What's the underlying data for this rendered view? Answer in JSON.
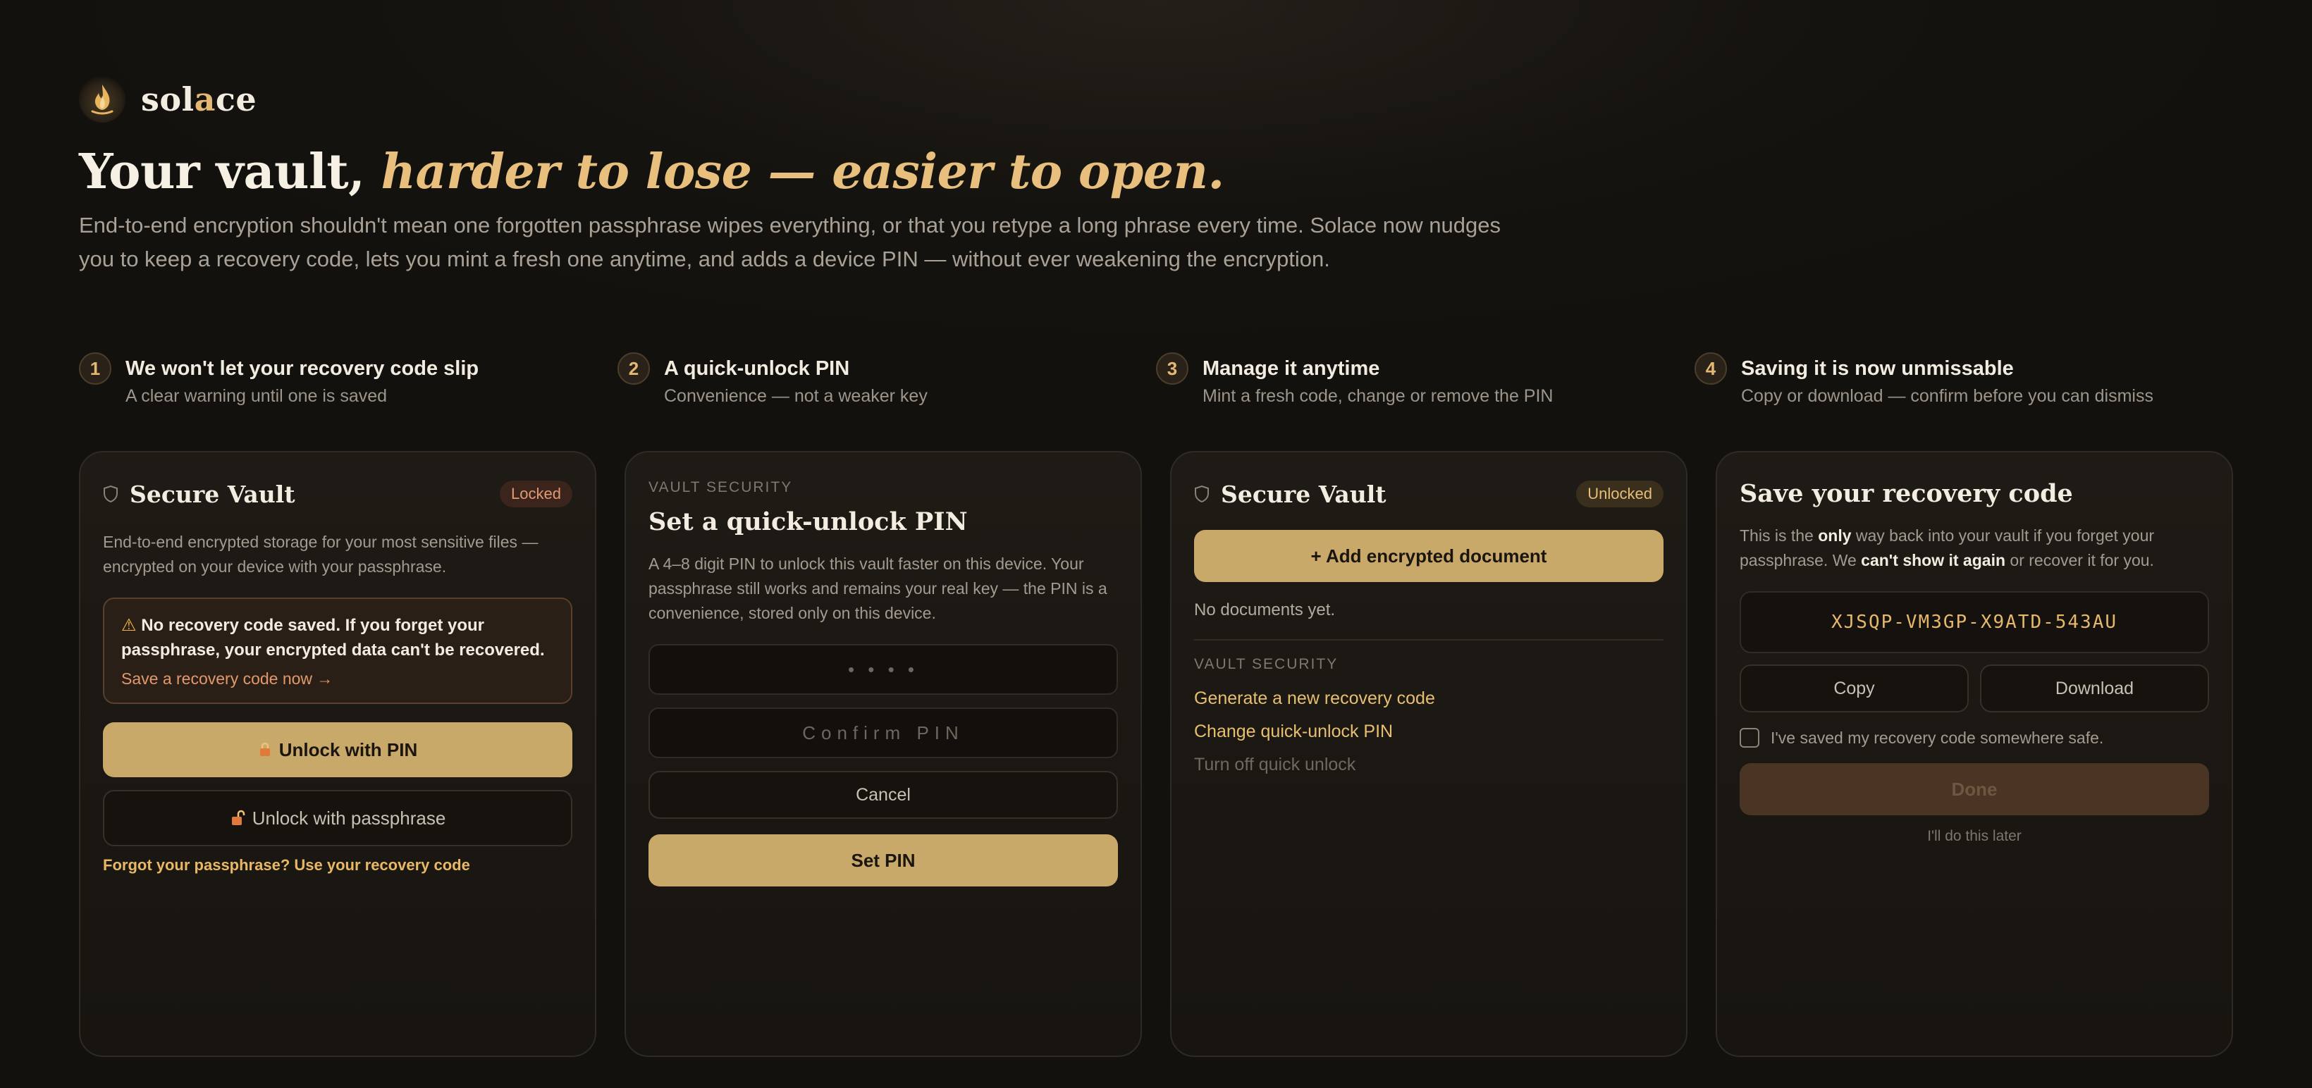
{
  "brand": {
    "name_pre": "sol",
    "name_accent": "a",
    "name_post": "ce"
  },
  "hero": {
    "headline_plain": "Your vault, ",
    "headline_accent": "harder to lose — easier to open.",
    "lede": "End-to-end encryption shouldn't mean one forgotten passphrase wipes everything, or that you retype a long phrase every time. Solace now nudges you to keep a recovery code, lets you mint a fresh one anytime, and adds a device PIN — without ever weakening the encryption."
  },
  "steps": [
    {
      "num": "1",
      "title": "We won't let your recovery code slip",
      "sub": "A clear warning until one is saved"
    },
    {
      "num": "2",
      "title": "A quick-unlock PIN",
      "sub": "Convenience — not a weaker key"
    },
    {
      "num": "3",
      "title": "Manage it anytime",
      "sub": "Mint a fresh code, change or remove the PIN"
    },
    {
      "num": "4",
      "title": "Saving it is now unmissable",
      "sub": "Copy or download — confirm before you can dismiss"
    }
  ],
  "card1": {
    "title": "Secure Vault",
    "badge": "Locked",
    "desc": "End-to-end encrypted storage for your most sensitive files — encrypted on your device with your passphrase.",
    "warning": "No recovery code saved. If you forget your passphrase, your encrypted data can't be recovered.",
    "warning_icon": "⚠",
    "warning_link": "Save a recovery code now →",
    "pin_button": "Unlock with PIN",
    "passphrase_button": "Unlock with passphrase",
    "forgot_link": "Forgot your passphrase? Use your recovery code"
  },
  "card2": {
    "kicker": "VAULT SECURITY",
    "title": "Set a quick-unlock PIN",
    "desc": "A 4–8 digit PIN to unlock this vault faster on this device. Your passphrase still works and remains your real key — the PIN is a convenience, stored only on this device.",
    "pin_placeholder": "• • • •",
    "confirm_placeholder": "Confirm PIN",
    "cancel": "Cancel",
    "set_pin": "Set PIN"
  },
  "card3": {
    "title": "Secure Vault",
    "badge": "Unlocked",
    "add_button": "+ Add encrypted document",
    "empty": "No documents yet.",
    "kicker": "VAULT SECURITY",
    "links": [
      "Generate a new recovery code",
      "Change quick-unlock PIN"
    ],
    "disabled_link": "Turn off quick unlock"
  },
  "card4": {
    "title": "Save your recovery code",
    "desc_a": "This is the ",
    "desc_b": "only",
    "desc_c": " way back into your vault if you forget your passphrase. We ",
    "desc_d": "can't show it again",
    "desc_e": " or recover it for you.",
    "code": "XJSQP-VM3GP-X9ATD-543AU",
    "copy": "Copy",
    "download": "Download",
    "checkbox_label": "I've saved my recovery code somewhere safe.",
    "done": "Done",
    "later": "I'll do this later"
  },
  "colors": {
    "accent": "#e8bf7c",
    "gold_button": "#c9a96a",
    "background": "#15130f",
    "warning": "#e2986c"
  },
  "icons": [
    "flame-logo-icon",
    "shield-icon",
    "warning-icon",
    "lock-icon",
    "unlock-icon"
  ]
}
